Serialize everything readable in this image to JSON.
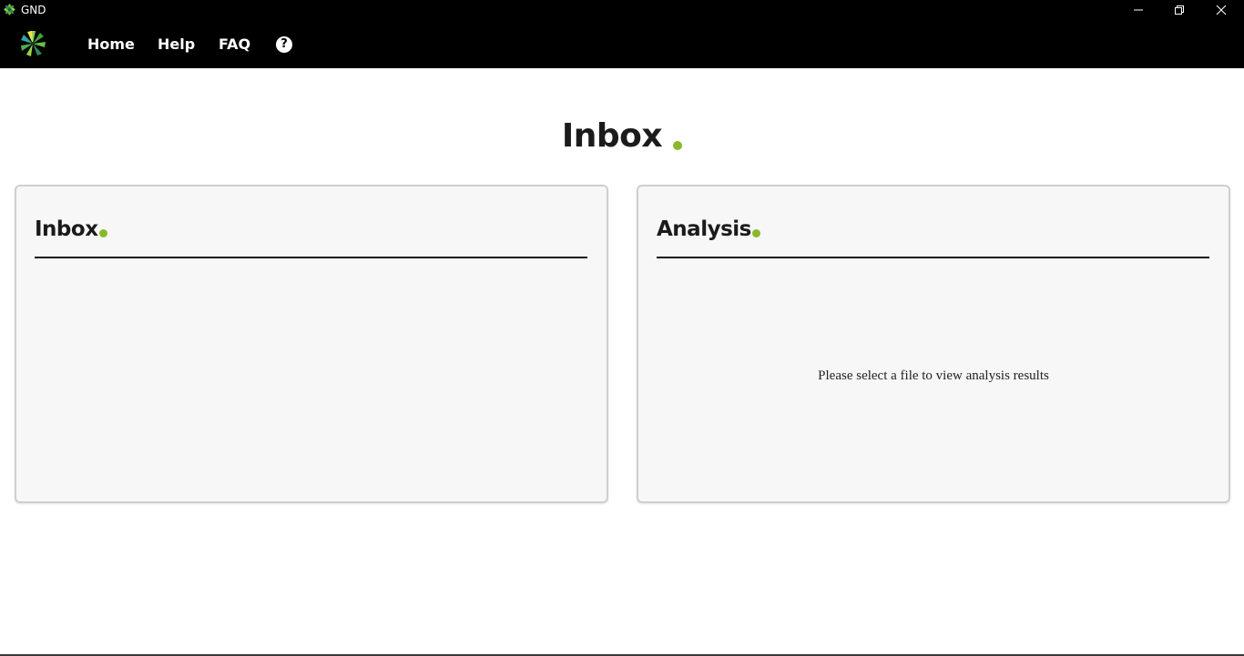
{
  "window": {
    "title": "GND",
    "app_icon": "gnd-logo-icon",
    "controls": [
      "minimize-icon",
      "maximize-icon",
      "close-icon"
    ]
  },
  "nav": {
    "logo": "gnd-logo-icon",
    "items": [
      {
        "label": "Home"
      },
      {
        "label": "Help"
      },
      {
        "label": "FAQ"
      }
    ],
    "help_icon_glyph": "?"
  },
  "page": {
    "heading": "Inbox",
    "accent_color": "#8ab82a"
  },
  "panels": {
    "inbox": {
      "title": "Inbox"
    },
    "analysis": {
      "title": "Analysis",
      "empty_message": "Please select a file to view analysis results"
    }
  }
}
